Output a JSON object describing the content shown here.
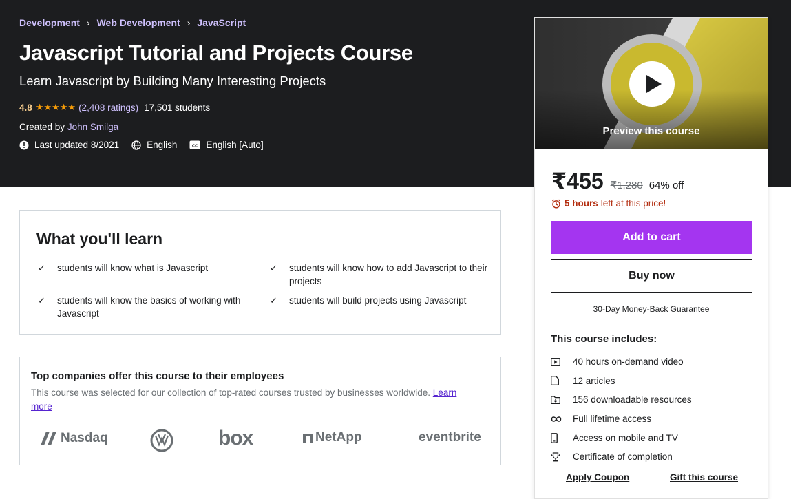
{
  "breadcrumb": [
    "Development",
    "Web Development",
    "JavaScript"
  ],
  "course": {
    "title": "Javascript Tutorial and Projects Course",
    "subtitle": "Learn Javascript by Building Many Interesting Projects",
    "rating": "4.8",
    "stars": "★★★★★",
    "ratings_count": "(2,408 ratings)",
    "students": "17,501 students",
    "created_by_label": "Created by",
    "instructor": "John Smilga",
    "last_updated": "Last updated 8/2021",
    "language": "English",
    "captions": "English [Auto]"
  },
  "learn": {
    "heading": "What you'll learn",
    "items": [
      "students will know what is Javascript",
      "students will know how to add Javascript to their projects",
      "students will know the basics of working with Javascript",
      "students will build projects using Javascript"
    ]
  },
  "companies": {
    "heading": "Top companies offer this course to their employees",
    "description": "This course was selected for our collection of top-rated courses trusted by businesses worldwide.",
    "learn_more": "Learn more",
    "logos": [
      "Nasdaq",
      "Volkswagen",
      "box",
      "NetApp",
      "eventbrite"
    ],
    "logo_text": {
      "nasdaq": "Nasdaq",
      "box": "box",
      "netapp": "NetApp",
      "eventbrite": "eventbrite"
    }
  },
  "sidebar": {
    "preview_label": "Preview this course",
    "price": "₹455",
    "original_price": "₹1,280",
    "discount": "64% off",
    "timer_bold": "5 hours",
    "timer_rest": "left at this price!",
    "add_to_cart": "Add to cart",
    "buy_now": "Buy now",
    "guarantee": "30-Day Money-Back Guarantee",
    "includes_title": "This course includes:",
    "includes": [
      {
        "icon": "video-icon",
        "label": "40 hours on-demand video"
      },
      {
        "icon": "file-icon",
        "label": "12 articles"
      },
      {
        "icon": "download-folder-icon",
        "label": "156 downloadable resources"
      },
      {
        "icon": "infinity-icon",
        "label": "Full lifetime access"
      },
      {
        "icon": "mobile-icon",
        "label": "Access on mobile and TV"
      },
      {
        "icon": "trophy-icon",
        "label": "Certificate of completion"
      }
    ],
    "apply_coupon": "Apply Coupon",
    "gift": "Gift this course"
  },
  "colors": {
    "hero_bg": "#1c1d1f",
    "link_purple": "#cec0fc",
    "cart_purple": "#a435f0",
    "star": "#f69c08",
    "timer_red": "#b32d0f"
  }
}
